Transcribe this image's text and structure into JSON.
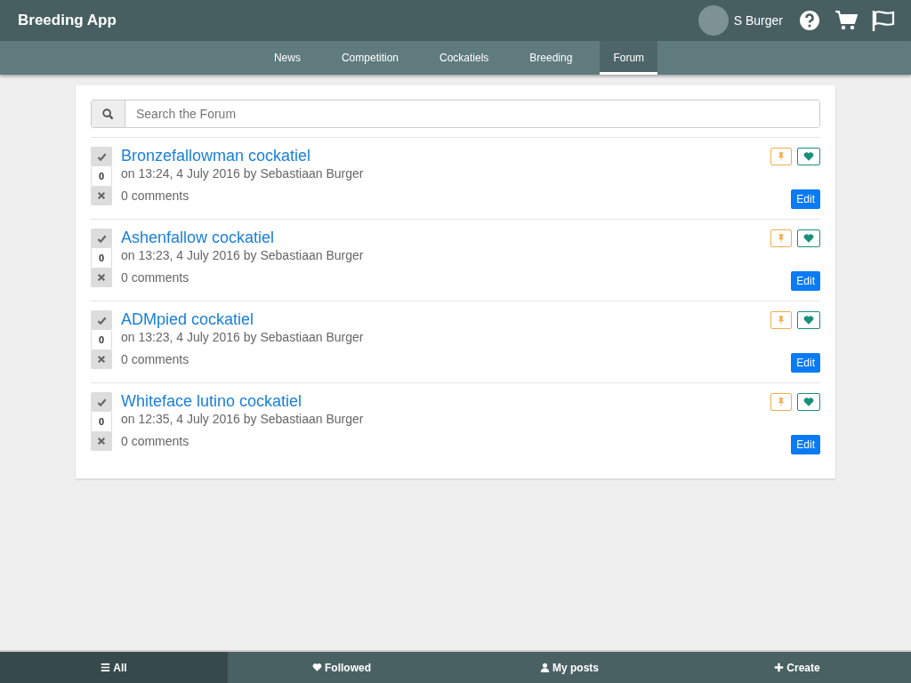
{
  "app_title": "Breeding App",
  "user": {
    "name": "S Burger"
  },
  "nav_tabs": [
    {
      "label": "News",
      "selected": false
    },
    {
      "label": "Competition",
      "selected": false
    },
    {
      "label": "Cockatiels",
      "selected": false
    },
    {
      "label": "Breeding",
      "selected": false
    },
    {
      "label": "Forum",
      "selected": true
    }
  ],
  "search": {
    "placeholder": "Search the Forum"
  },
  "posts": [
    {
      "title": "Bronzefallowman cockatiel",
      "meta": "on 13:24, 4 July 2016 by Sebastiaan Burger",
      "votes": "0",
      "comments": "0 comments",
      "edit": "Edit"
    },
    {
      "title": "Ashenfallow cockatiel",
      "meta": "on 13:23, 4 July 2016 by Sebastiaan Burger",
      "votes": "0",
      "comments": "0 comments",
      "edit": "Edit"
    },
    {
      "title": "ADMpied cockatiel",
      "meta": "on 13:23, 4 July 2016 by Sebastiaan Burger",
      "votes": "0",
      "comments": "0 comments",
      "edit": "Edit"
    },
    {
      "title": "Whiteface lutino cockatiel",
      "meta": "on 12:35, 4 July 2016 by Sebastiaan Burger",
      "votes": "0",
      "comments": "0 comments",
      "edit": "Edit"
    }
  ],
  "bottom_tabs": [
    {
      "kind": "all",
      "label": "All",
      "selected": true
    },
    {
      "kind": "followed",
      "label": "Followed",
      "selected": false
    },
    {
      "kind": "mine",
      "label": "My posts",
      "selected": false
    },
    {
      "kind": "create",
      "label": "Create",
      "selected": false
    }
  ]
}
